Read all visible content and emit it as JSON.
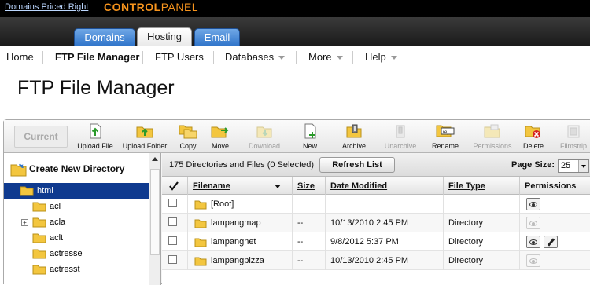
{
  "top_bar": {
    "brand_link": "Domains Priced Right",
    "logo_part1": "CONTROL",
    "logo_part2": "PANEL"
  },
  "primary_tabs": [
    {
      "label": "Domains",
      "active": false
    },
    {
      "label": "Hosting",
      "active": true
    },
    {
      "label": "Email",
      "active": false
    }
  ],
  "sub_nav": [
    {
      "label": "Home",
      "bold": false,
      "dropdown": false
    },
    {
      "label": "FTP File Manager",
      "bold": true,
      "dropdown": false
    },
    {
      "label": "FTP Users",
      "bold": false,
      "dropdown": false
    },
    {
      "label": "Databases",
      "bold": false,
      "dropdown": true
    },
    {
      "label": "More",
      "bold": false,
      "dropdown": true
    },
    {
      "label": "Help",
      "bold": false,
      "dropdown": true
    }
  ],
  "page_title": "FTP File Manager",
  "toolbar": {
    "current_label": "Current",
    "tools": [
      {
        "label": "Upload File",
        "icon": "upload-file-icon",
        "enabled": true
      },
      {
        "label": "Upload Folder",
        "icon": "upload-folder-icon",
        "enabled": true
      },
      {
        "label": "Copy",
        "icon": "copy-icon",
        "enabled": true
      },
      {
        "label": "Move",
        "icon": "move-icon",
        "enabled": true
      },
      {
        "label": "Download",
        "icon": "download-icon",
        "enabled": false
      },
      {
        "label": "New",
        "icon": "new-file-icon",
        "enabled": true
      },
      {
        "label": "Archive",
        "icon": "archive-icon",
        "enabled": true
      },
      {
        "label": "Unarchive",
        "icon": "unarchive-icon",
        "enabled": false
      },
      {
        "label": "Rename",
        "icon": "rename-icon",
        "enabled": true
      },
      {
        "label": "Permissions",
        "icon": "permissions-icon",
        "enabled": false
      },
      {
        "label": "Delete",
        "icon": "delete-icon",
        "enabled": true
      },
      {
        "label": "Filmstrip",
        "icon": "filmstrip-icon",
        "enabled": false
      }
    ]
  },
  "tree": {
    "create_new_directory": "Create New Directory",
    "items": [
      {
        "label": "html",
        "selected": true,
        "expandable": false,
        "level": 0
      },
      {
        "label": "acl",
        "selected": false,
        "expandable": false,
        "level": 1
      },
      {
        "label": "acla",
        "selected": false,
        "expandable": true,
        "level": 1
      },
      {
        "label": "aclt",
        "selected": false,
        "expandable": false,
        "level": 1
      },
      {
        "label": "actresse",
        "selected": false,
        "expandable": false,
        "level": 1
      },
      {
        "label": "actresst",
        "selected": false,
        "expandable": false,
        "level": 1
      }
    ]
  },
  "status": {
    "count_text": "175 Directories and Files (0 Selected)",
    "refresh_label": "Refresh List",
    "page_size_label": "Page Size:",
    "page_size_value": "25"
  },
  "table": {
    "headers": {
      "filename": "Filename",
      "size": "Size",
      "date_modified": "Date Modified",
      "file_type": "File Type",
      "permissions": "Permissions"
    },
    "rows": [
      {
        "name": "[Root]",
        "size": "",
        "date": "",
        "type": "",
        "view_perm": true,
        "edit_perm": false,
        "view_enabled": true
      },
      {
        "name": "lampangmap",
        "size": "--",
        "date": "10/13/2010 2:45 PM",
        "type": "Directory",
        "view_perm": true,
        "edit_perm": false,
        "view_enabled": false
      },
      {
        "name": "lampangnet",
        "size": "--",
        "date": "9/8/2012 5:37 PM",
        "type": "Directory",
        "view_perm": true,
        "edit_perm": true,
        "view_enabled": true
      },
      {
        "name": "lampangpizza",
        "size": "--",
        "date": "10/13/2010 2:45 PM",
        "type": "Directory",
        "view_perm": true,
        "edit_perm": false,
        "view_enabled": false
      }
    ]
  },
  "colors": {
    "tab_blue": "#2e73c9",
    "tree_selected": "#0f3a8f",
    "folder_yellow": "#f3c63f",
    "logo_orange": "#f7941d"
  }
}
